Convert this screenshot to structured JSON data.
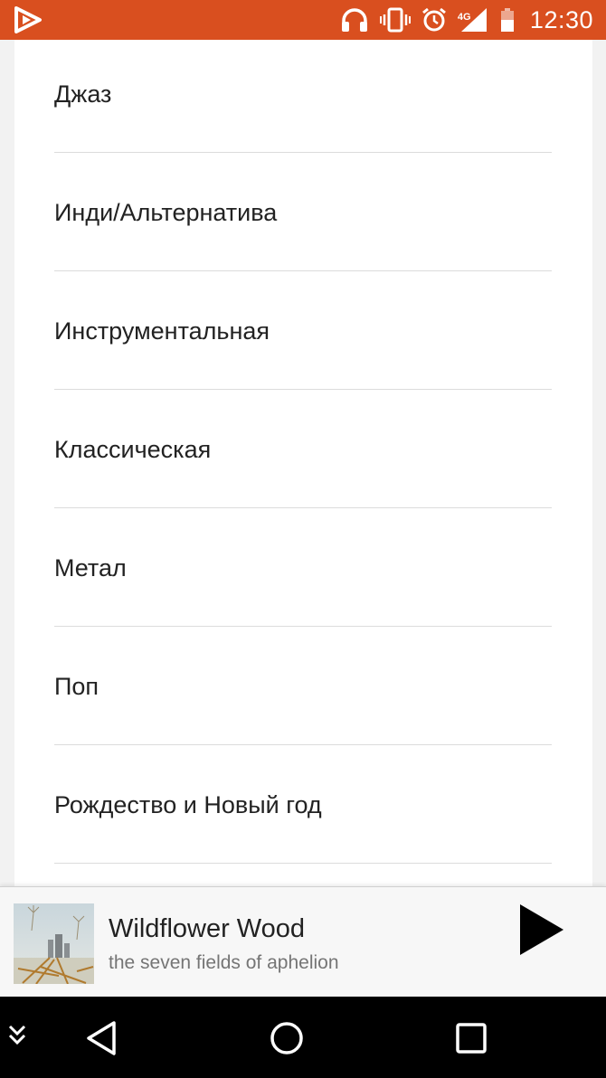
{
  "status_bar": {
    "time": "12:30",
    "network": "4G",
    "icons": [
      "app-logo-icon",
      "headphones-icon",
      "vibrate-icon",
      "alarm-icon",
      "signal-icon",
      "battery-icon"
    ],
    "background": "#d94f1f"
  },
  "genres": [
    {
      "label": "Джаз"
    },
    {
      "label": "Инди/Альтернатива"
    },
    {
      "label": "Инструментальная"
    },
    {
      "label": "Классическая"
    },
    {
      "label": "Метал"
    },
    {
      "label": "Поп"
    },
    {
      "label": "Рождество и Новый год"
    }
  ],
  "now_playing": {
    "title": "Wildflower Wood",
    "artist": "the seven fields of aphelion",
    "play_icon": "play-icon"
  },
  "nav_bar": {
    "icons": [
      "chevron-down-icon",
      "back-icon",
      "home-icon",
      "recents-icon"
    ]
  }
}
